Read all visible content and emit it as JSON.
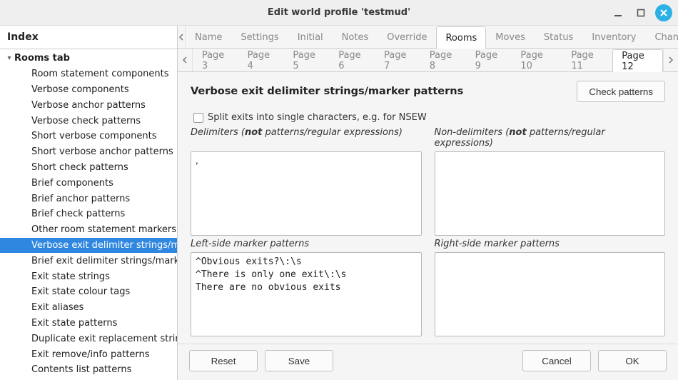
{
  "window": {
    "title": "Edit world profile 'testmud'"
  },
  "sidebar": {
    "title": "Index",
    "group": "Rooms tab",
    "items": [
      "Room statement components",
      "Verbose components",
      "Verbose anchor patterns",
      "Verbose check patterns",
      "Short verbose components",
      "Short verbose anchor patterns",
      "Short check patterns",
      "Brief components",
      "Brief anchor patterns",
      "Brief check patterns",
      "Other room statement markers",
      "Verbose exit delimiter strings/marker patterns",
      "Brief exit delimiter strings/marker patterns",
      "Exit state strings",
      "Exit state colour tags",
      "Exit aliases",
      "Exit state patterns",
      "Duplicate exit replacement string",
      "Exit remove/info patterns",
      "Contents list patterns"
    ],
    "selected_index": 11
  },
  "tabs_top": {
    "items": [
      "Name",
      "Settings",
      "Initial",
      "Notes",
      "Override",
      "Rooms",
      "Moves",
      "Status",
      "Inventory",
      "Channels"
    ],
    "active_index": 5
  },
  "tabs_pages": {
    "items": [
      "Page 3",
      "Page 4",
      "Page 5",
      "Page 6",
      "Page 7",
      "Page 8",
      "Page 9",
      "Page 10",
      "Page 11",
      "Page 12"
    ],
    "active_index": 9
  },
  "section_title": "Verbose exit delimiter strings/marker patterns",
  "check_patterns_btn": "Check patterns",
  "split_label": "Split exits into single characters, e.g. for NSEW",
  "labels": {
    "delim_prefix": "Delimiters (",
    "delim_not": "not",
    "delim_suffix": " patterns/regular expressions)",
    "nondelim_prefix": "Non-delimiters (",
    "nondelim_not": "not",
    "nondelim_suffix": " patterns/regular expressions)",
    "left_marker": "Left-side marker patterns",
    "right_marker": "Right-side marker patterns"
  },
  "textareas": {
    "delimiters": ",",
    "nondelimiters": "",
    "left_markers": "^Obvious exits?\\:\\s\n^There is only one exit\\:\\s\nThere are no obvious exits",
    "right_markers": ""
  },
  "footer": {
    "reset": "Reset",
    "save": "Save",
    "cancel": "Cancel",
    "ok": "OK"
  }
}
